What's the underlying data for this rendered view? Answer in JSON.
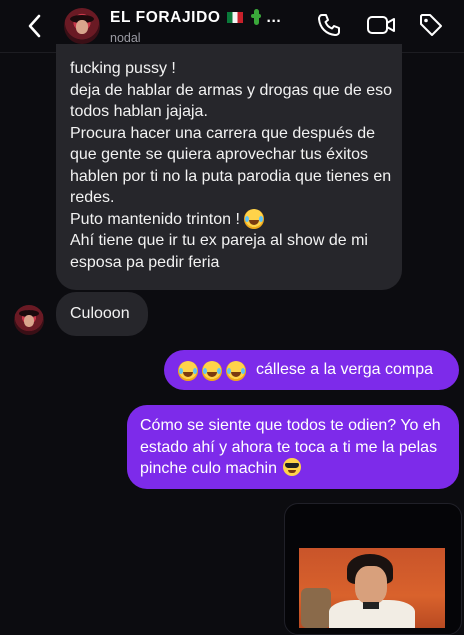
{
  "header": {
    "title": "EL FORAJIDO",
    "ellipsis": "...",
    "subtitle": "nodal"
  },
  "messages": {
    "incoming_long": "fucking pussy !\ndeja de hablar de armas y drogas que de eso todos hablan jajaja.\nProcura hacer una carrera que después de que gente se quiera aprovechar tus éxitos hablen por ti no la puta parodia que tienes en redes.\nPuto mantenido trinton ! 😂\nAhí tiene que ir tu ex pareja al show de mi esposa pa pedir feria",
    "incoming_short": "Culooon",
    "outgoing_1": "cállese a la verga compa",
    "outgoing_2": "Cómo se siente que todos te odien? Yo eh estado ahí y ahora te toca a ti me la pelas pinche culo machin"
  },
  "icons": {
    "back": "chevron-left-icon",
    "phone": "phone-icon",
    "video": "video-camera-icon",
    "tag": "tag-icon",
    "flag": "mexico-flag-icon",
    "cactus": "cactus-icon",
    "laugh": "tears-of-joy-emoji",
    "cool": "sunglasses-emoji"
  },
  "colors": {
    "background": "#0c0c10",
    "incoming_bubble": "#26262b",
    "outgoing_bubble": "#7d2bea"
  }
}
